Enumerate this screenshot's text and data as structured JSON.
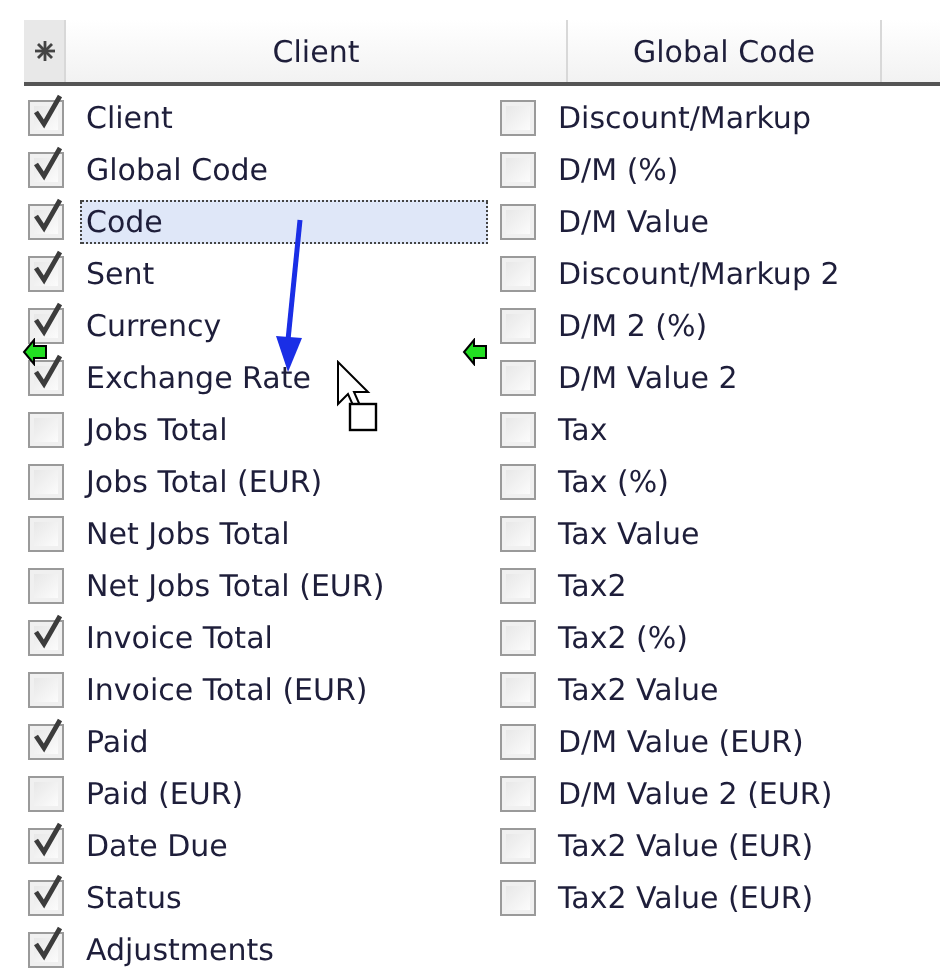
{
  "header": {
    "columns": [
      "Client",
      "Global Code"
    ]
  },
  "left_items": [
    {
      "label": "Client",
      "checked": true,
      "selected": false
    },
    {
      "label": "Global Code",
      "checked": true,
      "selected": false
    },
    {
      "label": "Code",
      "checked": true,
      "selected": true
    },
    {
      "label": "Sent",
      "checked": true,
      "selected": false
    },
    {
      "label": "Currency",
      "checked": true,
      "selected": false
    },
    {
      "label": "Exchange Rate",
      "checked": true,
      "selected": false
    },
    {
      "label": "Jobs Total",
      "checked": false,
      "selected": false
    },
    {
      "label": "Jobs Total (EUR)",
      "checked": false,
      "selected": false
    },
    {
      "label": "Net Jobs Total",
      "checked": false,
      "selected": false
    },
    {
      "label": "Net Jobs Total (EUR)",
      "checked": false,
      "selected": false
    },
    {
      "label": "Invoice Total",
      "checked": true,
      "selected": false
    },
    {
      "label": "Invoice Total (EUR)",
      "checked": false,
      "selected": false
    },
    {
      "label": "Paid",
      "checked": true,
      "selected": false
    },
    {
      "label": "Paid (EUR)",
      "checked": false,
      "selected": false
    },
    {
      "label": "Date Due",
      "checked": true,
      "selected": false
    },
    {
      "label": "Status",
      "checked": true,
      "selected": false
    },
    {
      "label": "Adjustments",
      "checked": true,
      "selected": false
    }
  ],
  "right_items": [
    {
      "label": "Discount/Markup",
      "checked": false,
      "selected": false
    },
    {
      "label": "D/M (%)",
      "checked": false,
      "selected": false
    },
    {
      "label": "D/M Value",
      "checked": false,
      "selected": false
    },
    {
      "label": "Discount/Markup 2",
      "checked": false,
      "selected": false
    },
    {
      "label": "D/M 2 (%)",
      "checked": false,
      "selected": false
    },
    {
      "label": "D/M Value 2",
      "checked": false,
      "selected": false
    },
    {
      "label": "Tax",
      "checked": false,
      "selected": false
    },
    {
      "label": "Tax (%)",
      "checked": false,
      "selected": false
    },
    {
      "label": "Tax Value",
      "checked": false,
      "selected": false
    },
    {
      "label": "Tax2",
      "checked": false,
      "selected": false
    },
    {
      "label": "Tax2 (%)",
      "checked": false,
      "selected": false
    },
    {
      "label": "Tax2 Value",
      "checked": false,
      "selected": false
    },
    {
      "label": "D/M Value (EUR)",
      "checked": false,
      "selected": false
    },
    {
      "label": "D/M Value 2 (EUR)",
      "checked": false,
      "selected": false
    },
    {
      "label": "Tax2 Value (EUR)",
      "checked": false,
      "selected": false
    },
    {
      "label": "Tax2 Value (EUR)",
      "checked": false,
      "selected": false
    }
  ]
}
